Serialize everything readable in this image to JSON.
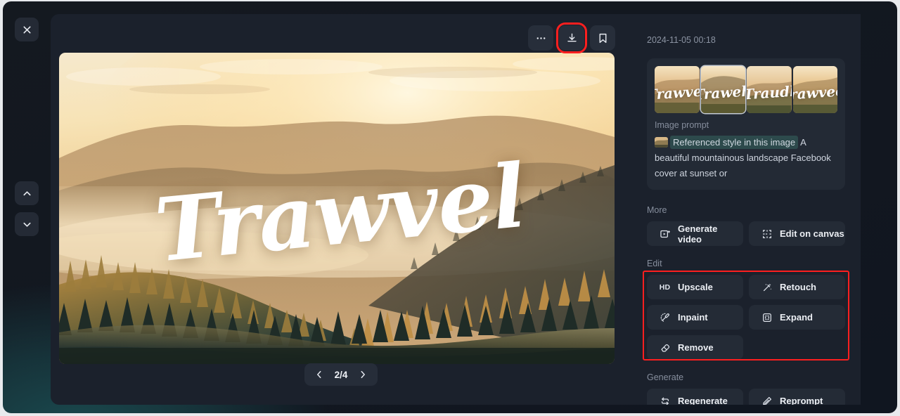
{
  "theme": {
    "highlight_color": "#fc1f1f",
    "panel_bg": "#1b212c",
    "button_bg": "#242b36",
    "chip_bg": "#2d4a4c",
    "accent_text": "#8b93a2"
  },
  "left_rail": {
    "close_label": "Close",
    "scroll_up_label": "Previous",
    "scroll_down_label": "Next"
  },
  "viewer": {
    "toolbar": [
      {
        "name": "more-options-button",
        "label": "More options",
        "icon": "ellipsis-icon",
        "highlighted": false
      },
      {
        "name": "download-button",
        "label": "Download",
        "icon": "download-icon",
        "highlighted": true
      },
      {
        "name": "bookmark-button",
        "label": "Bookmark",
        "icon": "bookmark-icon",
        "highlighted": false
      }
    ],
    "artwork_text": "Trawvel",
    "pager": {
      "prev_label": "Previous image",
      "next_label": "Next image",
      "count": "2/4",
      "current": 2,
      "total": 4
    }
  },
  "sidebar": {
    "timestamp": "2024-11-05 00:18",
    "thumbnails": [
      {
        "word": "Trawvel",
        "selected": false
      },
      {
        "word": "Traweh",
        "selected": true
      },
      {
        "word": "Traudl",
        "selected": false
      },
      {
        "word": "Trawveel",
        "selected": false
      }
    ],
    "prompt": {
      "label": "Image prompt",
      "chip_icon": "image-thumbnail-icon",
      "chip_label": "Referenced style in this image",
      "text": "A beautiful mountainous landscape Facebook cover at sunset or"
    },
    "more": {
      "label": "More",
      "buttons": [
        {
          "name": "generate-video-button",
          "label": "Generate video",
          "icon": "video-frame-icon"
        },
        {
          "name": "edit-on-canvas-button",
          "label": "Edit on canvas",
          "icon": "canvas-crop-icon"
        }
      ]
    },
    "edit": {
      "label": "Edit",
      "highlighted": true,
      "buttons": [
        {
          "name": "upscale-button",
          "label": "Upscale",
          "icon": "hd-badge-icon"
        },
        {
          "name": "retouch-button",
          "label": "Retouch",
          "icon": "magic-wand-icon"
        },
        {
          "name": "inpaint-button",
          "label": "Inpaint",
          "icon": "inpaint-brush-icon"
        },
        {
          "name": "expand-button",
          "label": "Expand",
          "icon": "expand-frame-icon"
        },
        {
          "name": "remove-button",
          "label": "Remove",
          "icon": "eraser-icon"
        }
      ]
    },
    "generate": {
      "label": "Generate",
      "buttons": [
        {
          "name": "regenerate-button",
          "label": "Regenerate",
          "icon": "refresh-icon"
        },
        {
          "name": "reprompt-button",
          "label": "Reprompt",
          "icon": "pencil-icon"
        }
      ]
    }
  }
}
